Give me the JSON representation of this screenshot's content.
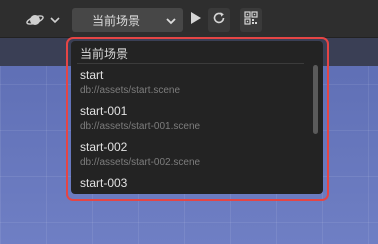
{
  "toolbar": {
    "scene_select": {
      "value": "当前场景"
    }
  },
  "dropdown": {
    "header": "当前场景",
    "items": [
      {
        "name": "start",
        "path": "db://assets/start.scene"
      },
      {
        "name": "start-001",
        "path": "db://assets/start-001.scene"
      },
      {
        "name": "start-002",
        "path": "db://assets/start-002.scene"
      },
      {
        "name": "start-003",
        "path": ""
      }
    ]
  },
  "colors": {
    "highlight": "#e54545",
    "dropdown_bg": "#232323",
    "select_bg": "#474747",
    "scene_bg": "#6676b8"
  },
  "icons": [
    "planet-icon",
    "chevron-down-icon",
    "play-icon",
    "refresh-icon",
    "qr-code-icon"
  ]
}
